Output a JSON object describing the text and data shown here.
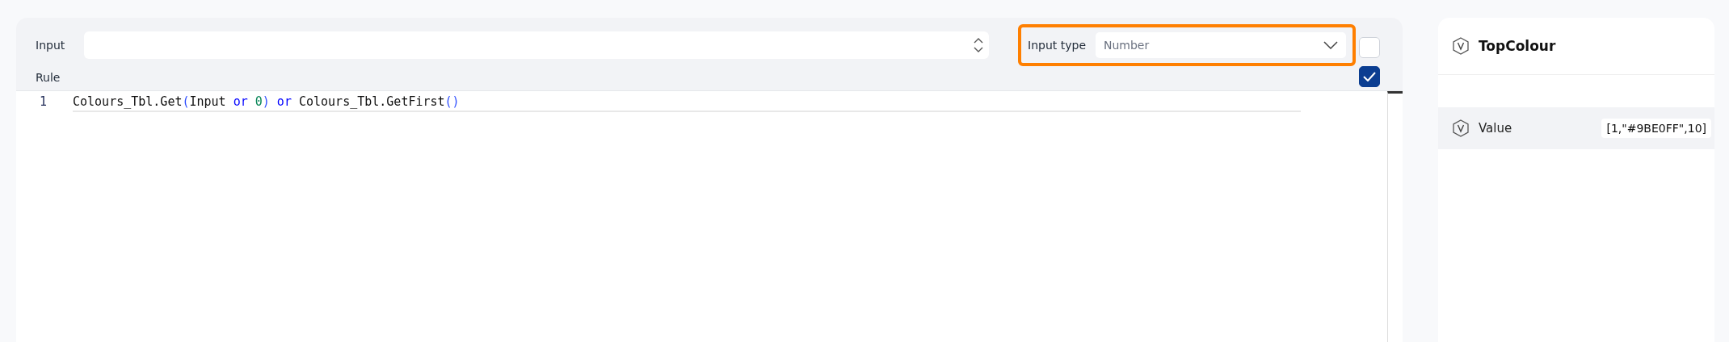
{
  "editor": {
    "input_label": "Input",
    "input_type_label": "Input type",
    "input_type_placeholder": "Number",
    "highlighted": true,
    "rule_label": "Rule",
    "checkboxes": [
      {
        "checked": false
      },
      {
        "checked": true
      }
    ],
    "lines": [
      {
        "number": "1",
        "tokens": [
          {
            "text": "Colours_Tbl.Get",
            "kind": "plain"
          },
          {
            "text": "(",
            "kind": "bracket"
          },
          {
            "text": "Input ",
            "kind": "plain"
          },
          {
            "text": "or ",
            "kind": "keyword"
          },
          {
            "text": "0",
            "kind": "number"
          },
          {
            "text": ")",
            "kind": "bracket"
          },
          {
            "text": " or ",
            "kind": "keyword"
          },
          {
            "text": "Colours_Tbl.GetFirst",
            "kind": "plain"
          },
          {
            "text": "()",
            "kind": "bracket"
          }
        ]
      }
    ]
  },
  "variable": {
    "title": "TopColour",
    "rows": [
      {
        "label": "Value",
        "value": "[1,\"#9BE0FF\",10]"
      }
    ]
  }
}
